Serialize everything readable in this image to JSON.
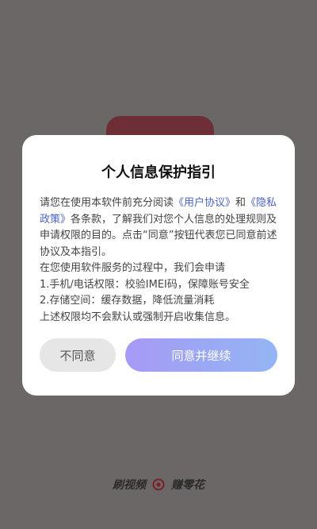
{
  "dialog": {
    "title": "个人信息保护指引",
    "text_prefix": "请您在使用本软件前充分阅读",
    "link_user_agreement": "《用户协议》",
    "text_and": "和",
    "link_privacy_policy": "《隐私政策》",
    "text_suffix": "各条款，了解我们对您个人信息的处理规则及申请权限的目的。点击“同意”按钮代表您已同意前述协议及本指引。",
    "service_intro": "在您使用软件服务的过程中，我们会申请",
    "permission_1": "1.手机/电话权限：校验IMEI码，保障账号安全",
    "permission_2": "2.存储空间：缓存数据，降低流量消耗",
    "closing": "上述权限均不会默认或强制开启收集信息。",
    "decline_label": "不同意",
    "agree_label": "同意并继续"
  },
  "brand": {
    "left_text": "刷视频",
    "right_text": "赚零花",
    "icon": "target-ring-icon"
  },
  "colors": {
    "overlay": "#6b6767",
    "link": "#4a64c9",
    "agree_gradient_start": "#a59af5",
    "agree_gradient_end": "#93b5f3",
    "decline_bg": "#e6e6e6"
  }
}
